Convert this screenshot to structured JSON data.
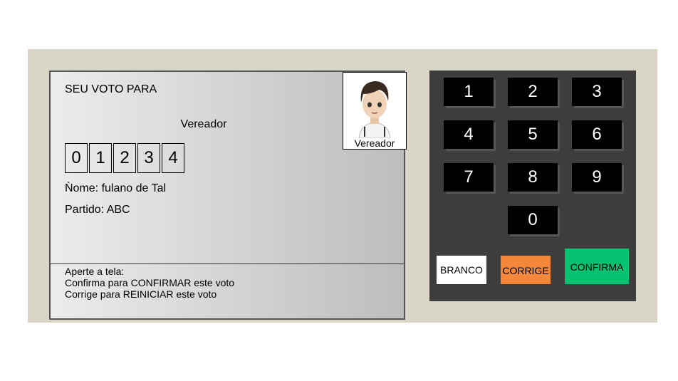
{
  "screen": {
    "title": "SEU VOTO PARA",
    "role": "Vereador",
    "digits": [
      "0",
      "1",
      "2",
      "3",
      "4"
    ],
    "name_line": "Ǹome: fulano de Tal",
    "party_line": "Partido: ABC",
    "photo_caption": "Vereador",
    "footer": {
      "line1": "Aperte a tela:",
      "line2": "Confirma para CONFIRMAR este voto",
      "line3": "Corrige para REINICIAR este voto"
    }
  },
  "keypad": {
    "keys": [
      "1",
      "2",
      "3",
      "4",
      "5",
      "6",
      "7",
      "8",
      "9",
      "0"
    ],
    "blank_label": "BRANCO",
    "correct_label": "CORRIGE",
    "confirm_label": "CONFIRMA"
  },
  "colors": {
    "blank": "#ffffff",
    "correct": "#f5873a",
    "confirm": "#08c272"
  }
}
